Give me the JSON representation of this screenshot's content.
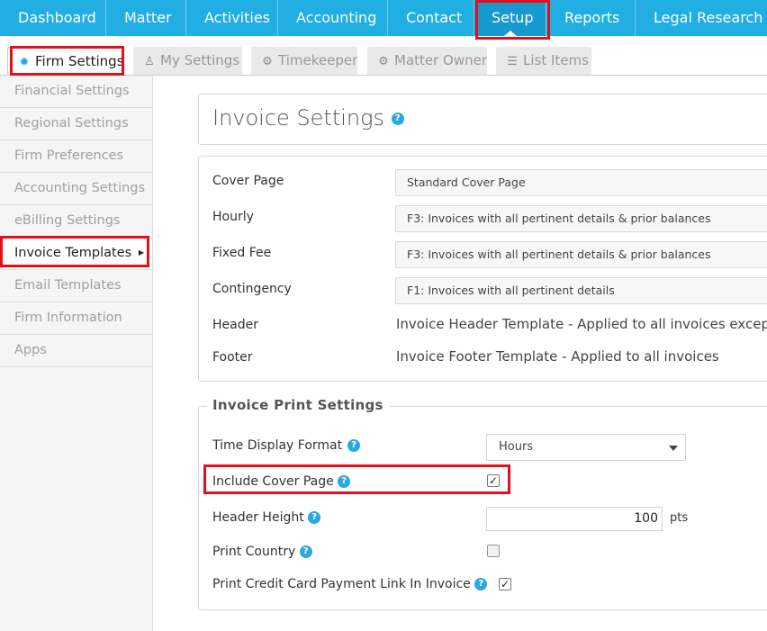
{
  "top_nav": {
    "items": [
      "Dashboard",
      "Matter",
      "Activities",
      "Accounting",
      "Contact",
      "Setup",
      "Reports",
      "Legal Research"
    ],
    "active": "Setup"
  },
  "sub_tabs": [
    {
      "label": "Firm Settings",
      "icon": "gear-icon"
    },
    {
      "label": "My Settings",
      "icon": "user-icon"
    },
    {
      "label": "Timekeeper",
      "icon": "gears-icon"
    },
    {
      "label": "Matter Owner",
      "icon": "gear-icon"
    },
    {
      "label": "List Items",
      "icon": "list-icon"
    }
  ],
  "sidebar": {
    "items": [
      "Financial Settings",
      "Regional Settings",
      "Firm Preferences",
      "Accounting Settings",
      "eBilling Settings",
      "Invoice Templates",
      "Email Templates",
      "Firm Information",
      "Apps"
    ],
    "active": "Invoice Templates"
  },
  "page": {
    "title": "Invoice Settings",
    "help_glyph": "?"
  },
  "templates": {
    "cover_page": {
      "label": "Cover Page",
      "value": "Standard Cover Page"
    },
    "hourly": {
      "label": "Hourly",
      "value": "F3: Invoices with all pertinent details & prior balances"
    },
    "fixed_fee": {
      "label": "Fixed Fee",
      "value": "F3: Invoices with all pertinent details & prior balances"
    },
    "contingency": {
      "label": "Contingency",
      "value": "F1: Invoices with all pertinent details"
    },
    "header": {
      "label": "Header",
      "value": "Invoice Header Template - Applied to all invoices except th"
    },
    "footer": {
      "label": "Footer",
      "value": "Invoice Footer Template - Applied to all invoices"
    }
  },
  "print_settings": {
    "legend": "Invoice Print Settings",
    "time_display_format": {
      "label": "Time Display Format",
      "value": "Hours"
    },
    "include_cover_page": {
      "label": "Include Cover Page",
      "checked": true
    },
    "header_height": {
      "label": "Header Height",
      "value": "100",
      "unit": "pts"
    },
    "print_country": {
      "label": "Print Country",
      "checked": false
    },
    "print_cc_link": {
      "label": "Print Credit Card Payment Link In Invoice",
      "checked": true
    }
  },
  "check_glyph": "✓",
  "colors": {
    "nav_bg": "#21aee3",
    "nav_active": "#1599cf",
    "accent": "#29a9df",
    "highlight": "#e3101a"
  }
}
